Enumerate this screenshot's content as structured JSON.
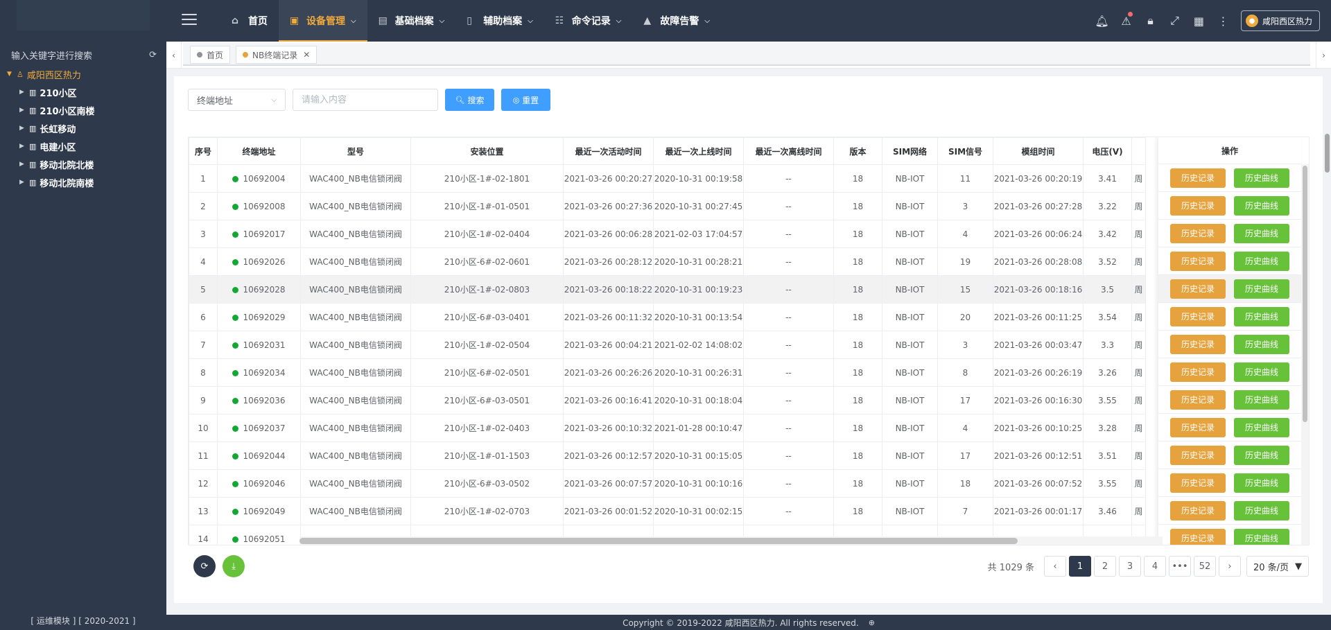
{
  "topbar": {
    "nav": [
      {
        "label": "首页",
        "icon": "home-icon",
        "glyph": "⌂",
        "caret": false,
        "active": false
      },
      {
        "label": "设备管理",
        "icon": "monitor-icon",
        "glyph": "▣",
        "caret": true,
        "active": true
      },
      {
        "label": "基础档案",
        "icon": "archive-icon",
        "glyph": "▤",
        "caret": true,
        "active": false
      },
      {
        "label": "辅助档案",
        "icon": "document-icon",
        "glyph": "▯",
        "caret": true,
        "active": false
      },
      {
        "label": "命令记录",
        "icon": "record-icon",
        "glyph": "☷",
        "caret": true,
        "active": false
      },
      {
        "label": "故障告警",
        "icon": "warning-icon",
        "glyph": "▲",
        "caret": true,
        "active": false
      }
    ],
    "user": "咸阳西区热力"
  },
  "sidebar": {
    "search_label": "输入关键字进行搜索",
    "root": "咸阳西区热力",
    "children": [
      "210小区",
      "210小区南楼",
      "长虹移动",
      "电建小区",
      "移动北院北楼",
      "移动北院南楼"
    ],
    "footer": "[ 运维模块 ] [ 2020-2021 ]"
  },
  "tabs": [
    {
      "label": "首页",
      "dot_color": "#909399",
      "closable": false
    },
    {
      "label": "NB终端记录",
      "dot_color": "#e6a23c",
      "closable": true
    }
  ],
  "filter": {
    "select_value": "终端地址",
    "input_placeholder": "请输入内容",
    "search_label": "搜索",
    "reset_label": "重置"
  },
  "table": {
    "columns": [
      "序号",
      "终端地址",
      "型号",
      "安装位置",
      "最近一次活动时间",
      "最近一次上线时间",
      "最近一次离线时间",
      "版本",
      "SIM网络",
      "SIM信号",
      "模组时间",
      "电压(V)",
      ""
    ],
    "ops_header": "操作",
    "op_history": "历史记录",
    "op_curve": "历史曲线",
    "rows": [
      [
        "1",
        "10692004",
        "WAC400_NB电信锁闭阀",
        "210小区-1#-02-1801",
        "2021-03-26 00:20:27",
        "2020-10-31 00:19:58",
        "--",
        "18",
        "NB-IOT",
        "11",
        "2021-03-26 00:20:19",
        "3.41",
        "周"
      ],
      [
        "2",
        "10692008",
        "WAC400_NB电信锁闭阀",
        "210小区-1#-01-0501",
        "2021-03-26 00:27:36",
        "2020-10-31 00:27:45",
        "--",
        "18",
        "NB-IOT",
        "3",
        "2021-03-26 00:27:28",
        "3.22",
        "周"
      ],
      [
        "3",
        "10692017",
        "WAC400_NB电信锁闭阀",
        "210小区-1#-02-0404",
        "2021-03-26 00:06:28",
        "2021-02-03 17:04:57",
        "--",
        "18",
        "NB-IOT",
        "4",
        "2021-03-26 00:06:24",
        "3.42",
        "周"
      ],
      [
        "4",
        "10692026",
        "WAC400_NB电信锁闭阀",
        "210小区-6#-02-0601",
        "2021-03-26 00:28:12",
        "2020-10-31 00:28:21",
        "--",
        "18",
        "NB-IOT",
        "19",
        "2021-03-26 00:28:08",
        "3.52",
        "周"
      ],
      [
        "5",
        "10692028",
        "WAC400_NB电信锁闭阀",
        "210小区-1#-02-0803",
        "2021-03-26 00:18:22",
        "2020-10-31 00:19:23",
        "--",
        "18",
        "NB-IOT",
        "15",
        "2021-03-26 00:18:16",
        "3.5",
        "周"
      ],
      [
        "6",
        "10692029",
        "WAC400_NB电信锁闭阀",
        "210小区-6#-03-0401",
        "2021-03-26 00:11:32",
        "2020-10-31 00:13:54",
        "--",
        "18",
        "NB-IOT",
        "20",
        "2021-03-26 00:11:25",
        "3.54",
        "周"
      ],
      [
        "7",
        "10692031",
        "WAC400_NB电信锁闭阀",
        "210小区-1#-02-0504",
        "2021-03-26 00:04:21",
        "2021-02-02 14:08:02",
        "--",
        "18",
        "NB-IOT",
        "3",
        "2021-03-26 00:03:47",
        "3.3",
        "周"
      ],
      [
        "8",
        "10692034",
        "WAC400_NB电信锁闭阀",
        "210小区-6#-02-0501",
        "2021-03-26 00:26:26",
        "2020-10-31 00:26:31",
        "--",
        "18",
        "NB-IOT",
        "8",
        "2021-03-26 00:26:19",
        "3.26",
        "周"
      ],
      [
        "9",
        "10692036",
        "WAC400_NB电信锁闭阀",
        "210小区-6#-03-0501",
        "2021-03-26 00:16:41",
        "2020-10-31 00:18:04",
        "--",
        "18",
        "NB-IOT",
        "17",
        "2021-03-26 00:16:30",
        "3.55",
        "周"
      ],
      [
        "10",
        "10692037",
        "WAC400_NB电信锁闭阀",
        "210小区-1#-02-0403",
        "2021-03-26 00:10:32",
        "2021-01-28 00:10:47",
        "--",
        "18",
        "NB-IOT",
        "4",
        "2021-03-26 00:10:25",
        "3.28",
        "周"
      ],
      [
        "11",
        "10692044",
        "WAC400_NB电信锁闭阀",
        "210小区-1#-01-1503",
        "2021-03-26 00:12:57",
        "2020-10-31 00:15:05",
        "--",
        "18",
        "NB-IOT",
        "17",
        "2021-03-26 00:12:51",
        "3.51",
        "周"
      ],
      [
        "12",
        "10692046",
        "WAC400_NB电信锁闭阀",
        "210小区-6#-03-0502",
        "2021-03-26 00:07:57",
        "2020-10-31 00:10:16",
        "--",
        "18",
        "NB-IOT",
        "18",
        "2021-03-26 00:07:52",
        "3.55",
        "周"
      ],
      [
        "13",
        "10692049",
        "WAC400_NB电信锁闭阀",
        "210小区-1#-02-0703",
        "2021-03-26 00:01:52",
        "2020-10-31 00:02:15",
        "--",
        "18",
        "NB-IOT",
        "7",
        "2021-03-26 00:01:17",
        "3.46",
        "周"
      ],
      [
        "14",
        "10692051",
        "",
        "",
        "",
        "",
        "",
        "",
        "",
        "",
        "",
        "",
        ""
      ]
    ],
    "highlight_row": 5
  },
  "pagination": {
    "total_label": "共 1029 条",
    "pages": [
      "1",
      "2",
      "3",
      "4",
      "•••",
      "52"
    ],
    "active_page": "1",
    "page_size": "20 条/页"
  },
  "footer": "Copyright © 2019-2022 咸阳西区热力. All rights reserved.",
  "colors": {
    "header_bg": "#2e3a4b",
    "accent": "#f0a93b",
    "primary": "#409eff",
    "warning": "#e6a23c",
    "success": "#67c23a",
    "online": "#13a832"
  }
}
